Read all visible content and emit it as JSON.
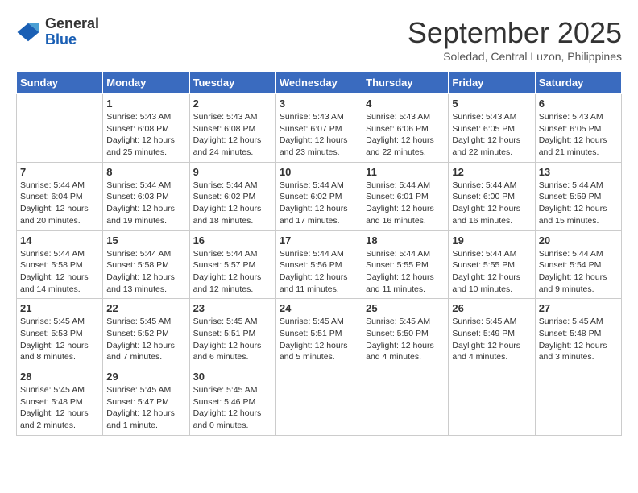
{
  "header": {
    "logo_line1": "General",
    "logo_line2": "Blue",
    "month_title": "September 2025",
    "subtitle": "Soledad, Central Luzon, Philippines"
  },
  "days_of_week": [
    "Sunday",
    "Monday",
    "Tuesday",
    "Wednesday",
    "Thursday",
    "Friday",
    "Saturday"
  ],
  "weeks": [
    [
      {
        "day": "",
        "info": ""
      },
      {
        "day": "1",
        "info": "Sunrise: 5:43 AM\nSunset: 6:08 PM\nDaylight: 12 hours\nand 25 minutes."
      },
      {
        "day": "2",
        "info": "Sunrise: 5:43 AM\nSunset: 6:08 PM\nDaylight: 12 hours\nand 24 minutes."
      },
      {
        "day": "3",
        "info": "Sunrise: 5:43 AM\nSunset: 6:07 PM\nDaylight: 12 hours\nand 23 minutes."
      },
      {
        "day": "4",
        "info": "Sunrise: 5:43 AM\nSunset: 6:06 PM\nDaylight: 12 hours\nand 22 minutes."
      },
      {
        "day": "5",
        "info": "Sunrise: 5:43 AM\nSunset: 6:05 PM\nDaylight: 12 hours\nand 22 minutes."
      },
      {
        "day": "6",
        "info": "Sunrise: 5:43 AM\nSunset: 6:05 PM\nDaylight: 12 hours\nand 21 minutes."
      }
    ],
    [
      {
        "day": "7",
        "info": "Sunrise: 5:44 AM\nSunset: 6:04 PM\nDaylight: 12 hours\nand 20 minutes."
      },
      {
        "day": "8",
        "info": "Sunrise: 5:44 AM\nSunset: 6:03 PM\nDaylight: 12 hours\nand 19 minutes."
      },
      {
        "day": "9",
        "info": "Sunrise: 5:44 AM\nSunset: 6:02 PM\nDaylight: 12 hours\nand 18 minutes."
      },
      {
        "day": "10",
        "info": "Sunrise: 5:44 AM\nSunset: 6:02 PM\nDaylight: 12 hours\nand 17 minutes."
      },
      {
        "day": "11",
        "info": "Sunrise: 5:44 AM\nSunset: 6:01 PM\nDaylight: 12 hours\nand 16 minutes."
      },
      {
        "day": "12",
        "info": "Sunrise: 5:44 AM\nSunset: 6:00 PM\nDaylight: 12 hours\nand 16 minutes."
      },
      {
        "day": "13",
        "info": "Sunrise: 5:44 AM\nSunset: 5:59 PM\nDaylight: 12 hours\nand 15 minutes."
      }
    ],
    [
      {
        "day": "14",
        "info": "Sunrise: 5:44 AM\nSunset: 5:58 PM\nDaylight: 12 hours\nand 14 minutes."
      },
      {
        "day": "15",
        "info": "Sunrise: 5:44 AM\nSunset: 5:58 PM\nDaylight: 12 hours\nand 13 minutes."
      },
      {
        "day": "16",
        "info": "Sunrise: 5:44 AM\nSunset: 5:57 PM\nDaylight: 12 hours\nand 12 minutes."
      },
      {
        "day": "17",
        "info": "Sunrise: 5:44 AM\nSunset: 5:56 PM\nDaylight: 12 hours\nand 11 minutes."
      },
      {
        "day": "18",
        "info": "Sunrise: 5:44 AM\nSunset: 5:55 PM\nDaylight: 12 hours\nand 11 minutes."
      },
      {
        "day": "19",
        "info": "Sunrise: 5:44 AM\nSunset: 5:55 PM\nDaylight: 12 hours\nand 10 minutes."
      },
      {
        "day": "20",
        "info": "Sunrise: 5:44 AM\nSunset: 5:54 PM\nDaylight: 12 hours\nand 9 minutes."
      }
    ],
    [
      {
        "day": "21",
        "info": "Sunrise: 5:45 AM\nSunset: 5:53 PM\nDaylight: 12 hours\nand 8 minutes."
      },
      {
        "day": "22",
        "info": "Sunrise: 5:45 AM\nSunset: 5:52 PM\nDaylight: 12 hours\nand 7 minutes."
      },
      {
        "day": "23",
        "info": "Sunrise: 5:45 AM\nSunset: 5:51 PM\nDaylight: 12 hours\nand 6 minutes."
      },
      {
        "day": "24",
        "info": "Sunrise: 5:45 AM\nSunset: 5:51 PM\nDaylight: 12 hours\nand 5 minutes."
      },
      {
        "day": "25",
        "info": "Sunrise: 5:45 AM\nSunset: 5:50 PM\nDaylight: 12 hours\nand 4 minutes."
      },
      {
        "day": "26",
        "info": "Sunrise: 5:45 AM\nSunset: 5:49 PM\nDaylight: 12 hours\nand 4 minutes."
      },
      {
        "day": "27",
        "info": "Sunrise: 5:45 AM\nSunset: 5:48 PM\nDaylight: 12 hours\nand 3 minutes."
      }
    ],
    [
      {
        "day": "28",
        "info": "Sunrise: 5:45 AM\nSunset: 5:48 PM\nDaylight: 12 hours\nand 2 minutes."
      },
      {
        "day": "29",
        "info": "Sunrise: 5:45 AM\nSunset: 5:47 PM\nDaylight: 12 hours\nand 1 minute."
      },
      {
        "day": "30",
        "info": "Sunrise: 5:45 AM\nSunset: 5:46 PM\nDaylight: 12 hours\nand 0 minutes."
      },
      {
        "day": "",
        "info": ""
      },
      {
        "day": "",
        "info": ""
      },
      {
        "day": "",
        "info": ""
      },
      {
        "day": "",
        "info": ""
      }
    ]
  ]
}
